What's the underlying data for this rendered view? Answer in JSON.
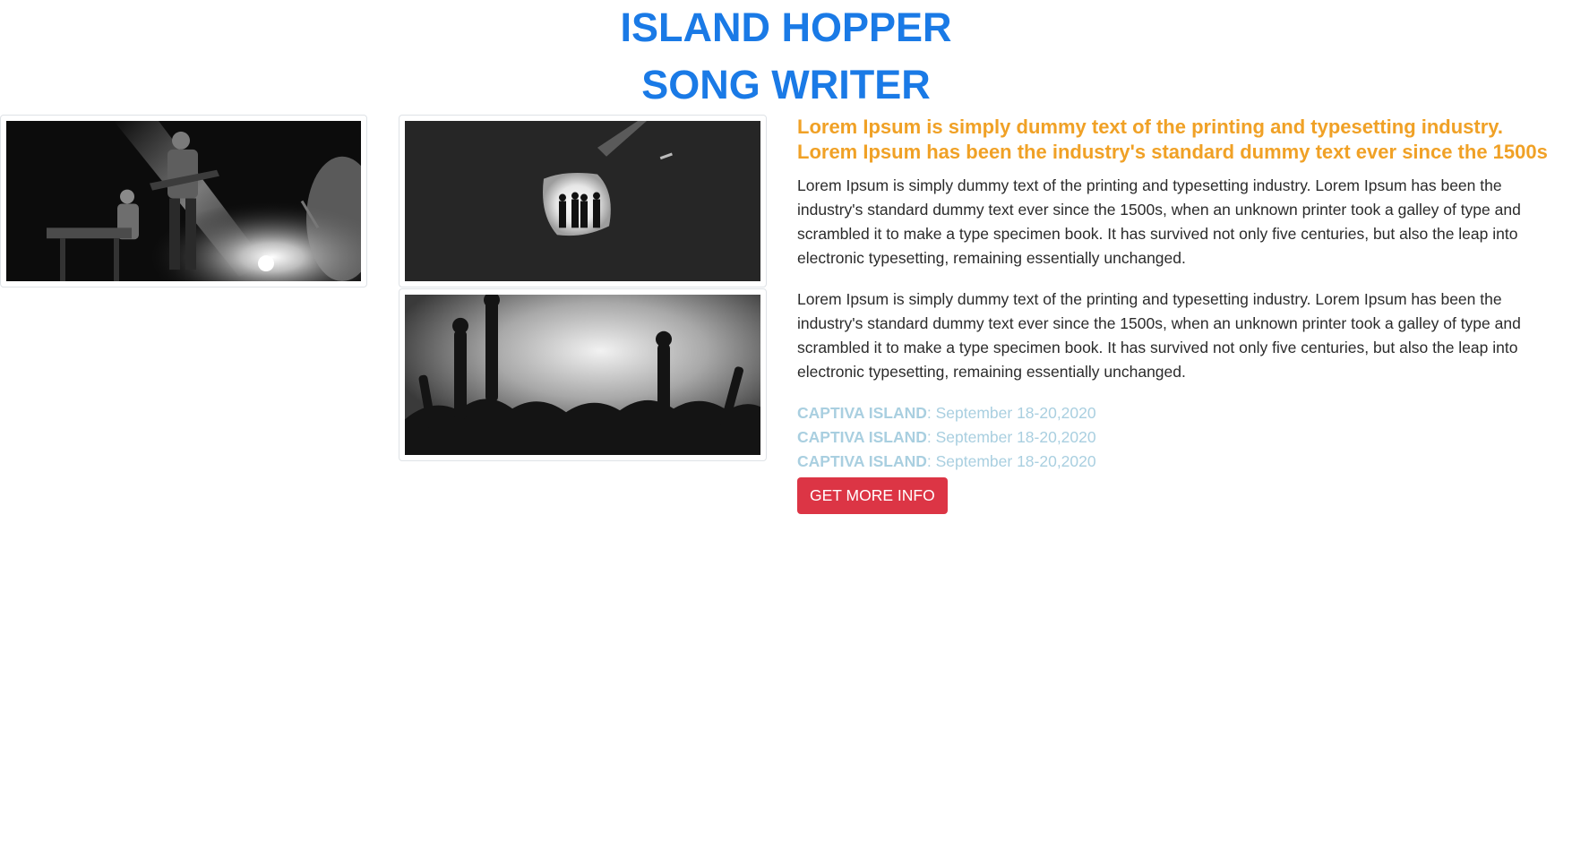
{
  "header": {
    "title_line1": "ISLAND HOPPER",
    "title_line2": "SONG WRITER"
  },
  "gallery": {
    "images": [
      {
        "name": "concert-band-photo"
      },
      {
        "name": "tunnel-silhouettes-photo"
      },
      {
        "name": "crowd-hands-photo"
      }
    ]
  },
  "content": {
    "lead": "Lorem Ipsum is simply dummy text of the printing and typesetting industry. Lorem Ipsum has been the industry's standard dummy text ever since the 1500s",
    "paragraphs": [
      "Lorem Ipsum is simply dummy text of the printing and typesetting industry. Lorem Ipsum has been the industry's standard dummy text ever since the 1500s, when an unknown printer took a galley of type and scrambled it to make a type specimen book. It has survived not only five centuries, but also the leap into electronic typesetting, remaining essentially unchanged.",
      "Lorem Ipsum is simply dummy text of the printing and typesetting industry. Lorem Ipsum has been the industry's standard dummy text ever since the 1500s, when an unknown printer took a galley of type and scrambled it to make a type specimen book. It has survived not only five centuries, but also the leap into electronic typesetting, remaining essentially unchanged."
    ],
    "events": [
      {
        "place": "CAPTIVA ISLAND",
        "date": ": September 18-20,2020"
      },
      {
        "place": "CAPTIVA ISLAND",
        "date": ": September 18-20,2020"
      },
      {
        "place": "CAPTIVA ISLAND",
        "date": ": September 18-20,2020"
      }
    ],
    "button_label": "GET MORE INFO"
  },
  "colors": {
    "title": "#1a7ae6",
    "lead": "#f0a126",
    "event": "#a9cfe0",
    "button": "#dc3545"
  }
}
